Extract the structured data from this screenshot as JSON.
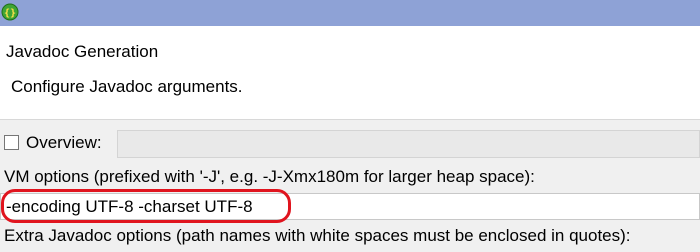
{
  "window": {
    "icon": "javadoc-braces-icon"
  },
  "header": {
    "title": "Javadoc Generation",
    "description": "Configure Javadoc arguments."
  },
  "overview": {
    "label": "Overview:",
    "checked": false,
    "value": ""
  },
  "vm_options": {
    "label": "VM options (prefixed with '-J', e.g. -J-Xmx180m for larger heap space):",
    "value": "-encoding UTF-8 -charset UTF-8"
  },
  "extra_options": {
    "label": "Extra Javadoc options (path names with white spaces must be enclosed in quotes):"
  },
  "colors": {
    "titlebar": "#8ea2d6",
    "highlight": "#e0141e",
    "icon_green": "#3fa535"
  }
}
